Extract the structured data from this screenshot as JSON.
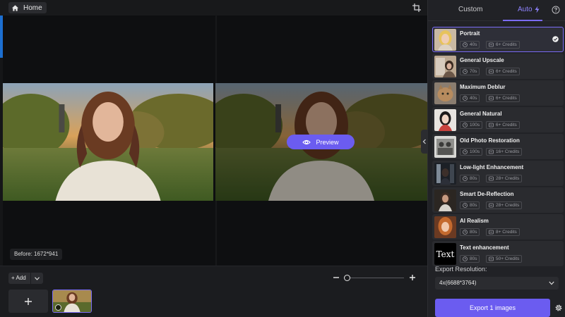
{
  "topbar": {
    "home_label": "Home"
  },
  "canvas": {
    "before_label": "Before: 1672*941"
  },
  "preview": {
    "label": "Preview"
  },
  "bottom": {
    "add_label": "+ Add"
  },
  "panel": {
    "tabs": [
      {
        "label": "Custom",
        "active": false
      },
      {
        "label": "Auto",
        "active": true
      }
    ],
    "presets": [
      {
        "name": "Portrait",
        "time": "40s",
        "credits": "6+ Credits",
        "selected": true,
        "icon": "portrait-thumbnail"
      },
      {
        "name": "General Upscale",
        "time": "70s",
        "credits": "6+ Credits",
        "selected": false,
        "icon": "upscale-thumbnail"
      },
      {
        "name": "Maximum Deblur",
        "time": "40s",
        "credits": "6+ Credits",
        "selected": false,
        "icon": "deblur-thumbnail"
      },
      {
        "name": "General Natural",
        "time": "100s",
        "credits": "6+ Credits",
        "selected": false,
        "icon": "natural-thumbnail"
      },
      {
        "name": "Old Photo Restoration",
        "time": "100s",
        "credits": "16+ Credits",
        "selected": false,
        "icon": "old-photo-thumbnail"
      },
      {
        "name": "Low-light Enhancement",
        "time": "80s",
        "credits": "28+ Credits",
        "selected": false,
        "icon": "low-light-thumbnail"
      },
      {
        "name": "Smart De-Reflection",
        "time": "80s",
        "credits": "28+ Credits",
        "selected": false,
        "icon": "de-reflection-thumbnail"
      },
      {
        "name": "AI Realism",
        "time": "80s",
        "credits": "8+ Credits",
        "selected": false,
        "icon": "realism-thumbnail"
      },
      {
        "name": "Text enhancement",
        "time": "80s",
        "credits": "50+ Credits",
        "selected": false,
        "icon": "text-thumbnail",
        "thumb_text": "Text"
      }
    ],
    "export_label": "Export Resolution:",
    "resolution_value": "4x(6688*3764)",
    "export_button": "Export 1 images"
  },
  "colors": {
    "accent": "#6b5cf0",
    "accent_light": "#8f83ff",
    "panel_bg": "#212226",
    "canvas_bg": "#0e0f11"
  }
}
